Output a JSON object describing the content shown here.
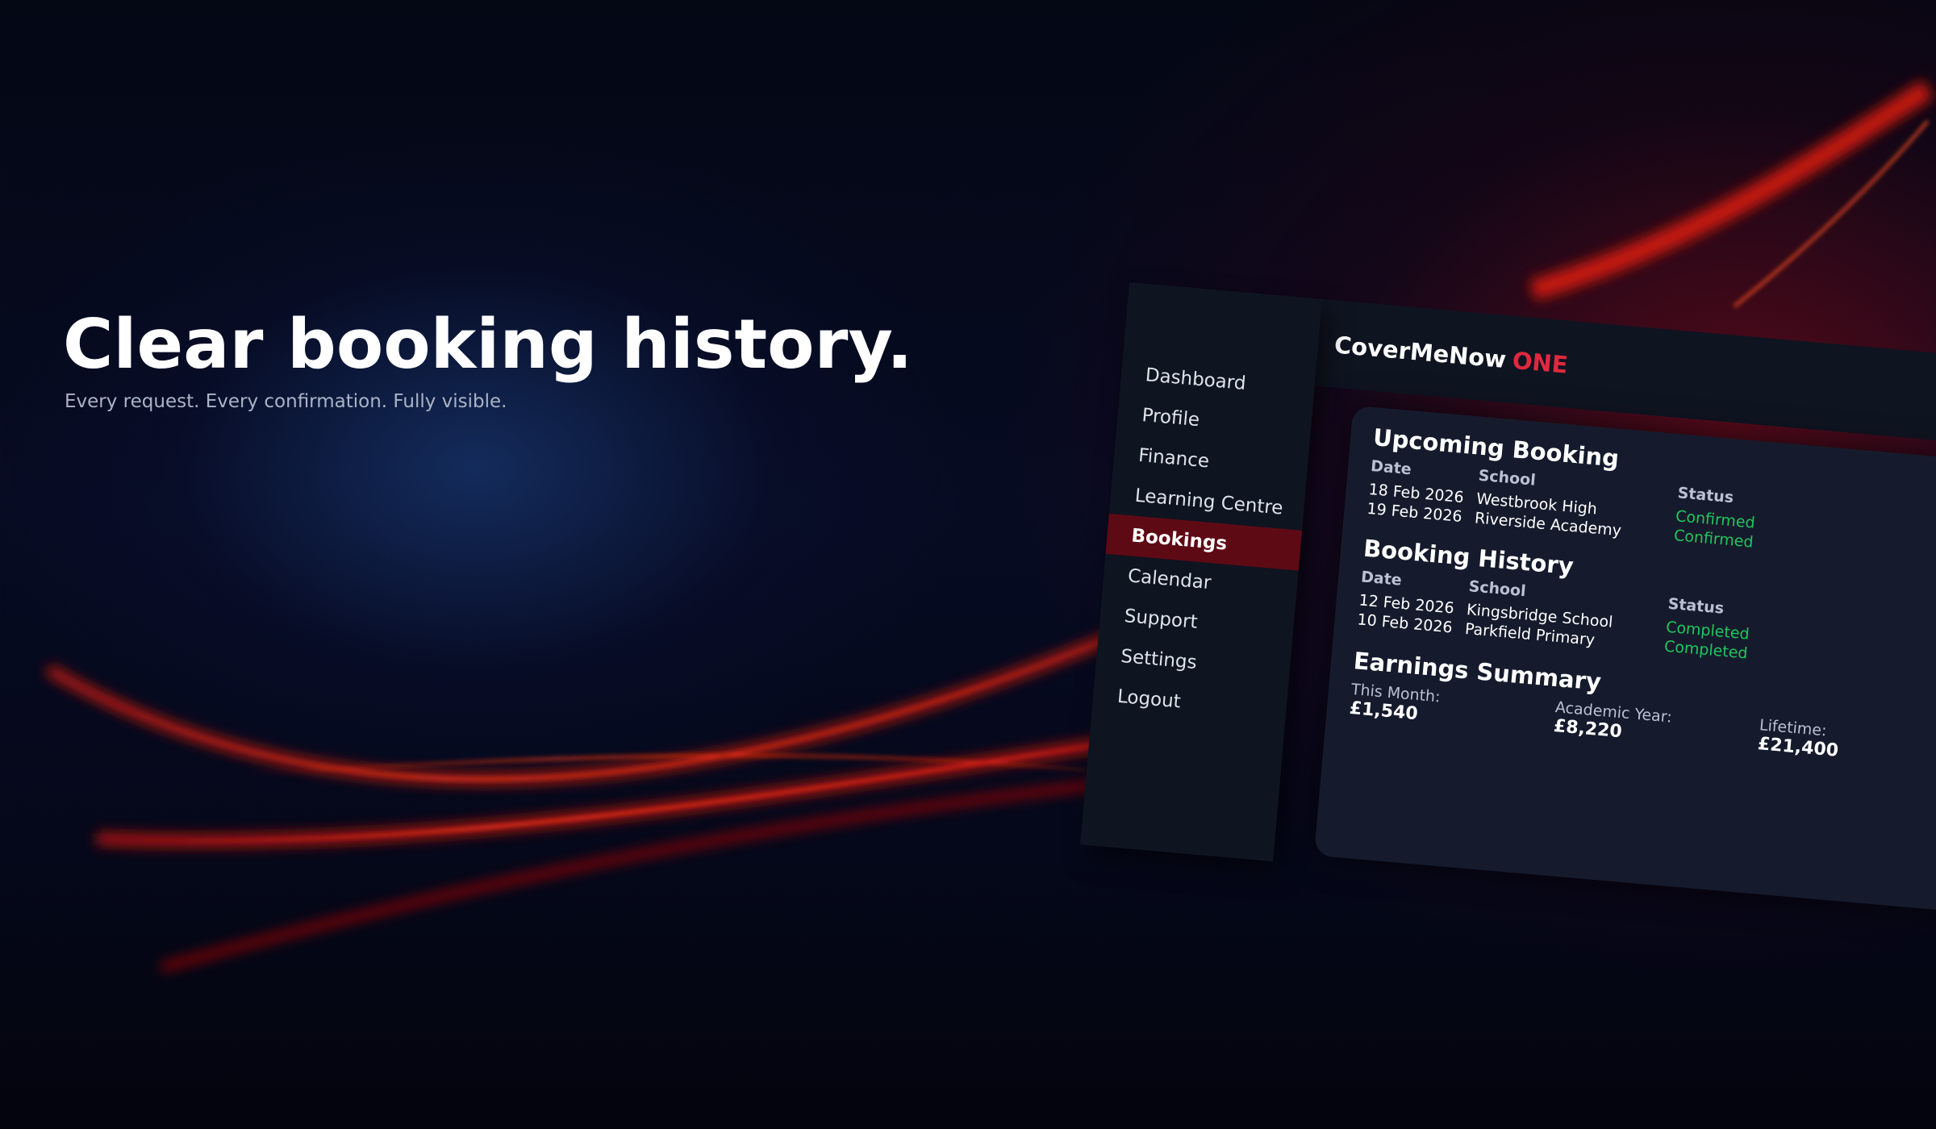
{
  "hero": {
    "title": "Clear booking history.",
    "subtitle": "Every request. Every confirmation. Fully visible."
  },
  "app": {
    "brand": {
      "name": "CoverMeNow",
      "accent": "ONE"
    },
    "sidebar": {
      "items": [
        {
          "label": "Dashboard",
          "active": false
        },
        {
          "label": "Profile",
          "active": false
        },
        {
          "label": "Finance",
          "active": false
        },
        {
          "label": "Learning Centre",
          "active": false
        },
        {
          "label": "Bookings",
          "active": true
        },
        {
          "label": "Calendar",
          "active": false
        },
        {
          "label": "Support",
          "active": false
        },
        {
          "label": "Settings",
          "active": false
        },
        {
          "label": "Logout",
          "active": false
        }
      ]
    },
    "upcoming": {
      "title": "Upcoming Booking",
      "headers": {
        "date": "Date",
        "school": "School",
        "status": "Status"
      },
      "rows": [
        {
          "date": "18 Feb 2026",
          "school": "Westbrook High",
          "status": "Confirmed"
        },
        {
          "date": "19 Feb 2026",
          "school": "Riverside Academy",
          "status": "Confirmed"
        }
      ]
    },
    "history": {
      "title": "Booking History",
      "headers": {
        "date": "Date",
        "school": "School",
        "status": "Status"
      },
      "rows": [
        {
          "date": "12 Feb 2026",
          "school": "Kingsbridge School",
          "status": "Completed"
        },
        {
          "date": "10 Feb 2026",
          "school": "Parkfield Primary",
          "status": "Completed"
        }
      ]
    },
    "earnings": {
      "title": "Earnings Summary",
      "this_month": {
        "label": "This Month:",
        "value": "£1,540"
      },
      "academic_year": {
        "label": "Academic Year:",
        "value": "£8,220"
      },
      "lifetime": {
        "label": "Lifetime:",
        "value": "£21,400"
      }
    }
  },
  "colors": {
    "accent": "#e0283f",
    "active_nav": "#5e0a14",
    "status_green": "#22c55e",
    "panel": "#151b2c",
    "sidebar": "#0f1421"
  }
}
